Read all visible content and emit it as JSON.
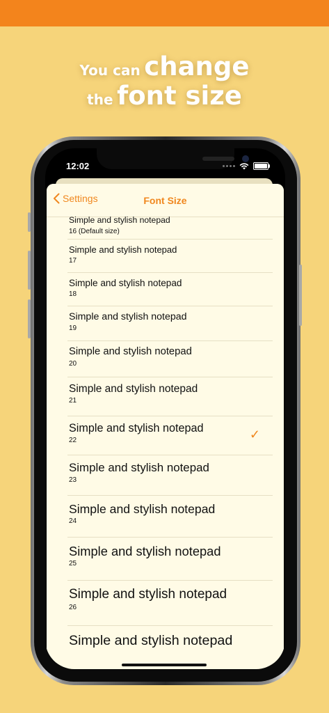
{
  "headline": {
    "line1_small": "You can",
    "line1_big": "change",
    "line2_small": "the",
    "line2_big": "font size"
  },
  "status_bar": {
    "time": "12:02",
    "icons": [
      "signal-dots-icon",
      "wifi-icon",
      "battery-icon"
    ]
  },
  "nav": {
    "back_label": "Settings",
    "title": "Font Size",
    "back_icon": "chevron-left-icon"
  },
  "accent_color": "#f0871e",
  "font_sizes": [
    {
      "label": "Simple and stylish notepad",
      "size": "16 (Default size)",
      "selected": false
    },
    {
      "label": "Simple and stylish notepad",
      "size": "17",
      "selected": false
    },
    {
      "label": "Simple and stylish notepad",
      "size": "18",
      "selected": false
    },
    {
      "label": "Simple and stylish notepad",
      "size": "19",
      "selected": false
    },
    {
      "label": "Simple and stylish notepad",
      "size": "20",
      "selected": false
    },
    {
      "label": "Simple and stylish notepad",
      "size": "21",
      "selected": false
    },
    {
      "label": "Simple and stylish notepad",
      "size": "22",
      "selected": true
    },
    {
      "label": "Simple and stylish notepad",
      "size": "23",
      "selected": false
    },
    {
      "label": "Simple and stylish notepad",
      "size": "24",
      "selected": false
    },
    {
      "label": "Simple and stylish notepad",
      "size": "25",
      "selected": false
    },
    {
      "label": "Simple and stylish notepad",
      "size": "26",
      "selected": false
    },
    {
      "label": "Simple and stylish notepad",
      "size": "",
      "selected": false
    }
  ],
  "check_glyph": "✓"
}
